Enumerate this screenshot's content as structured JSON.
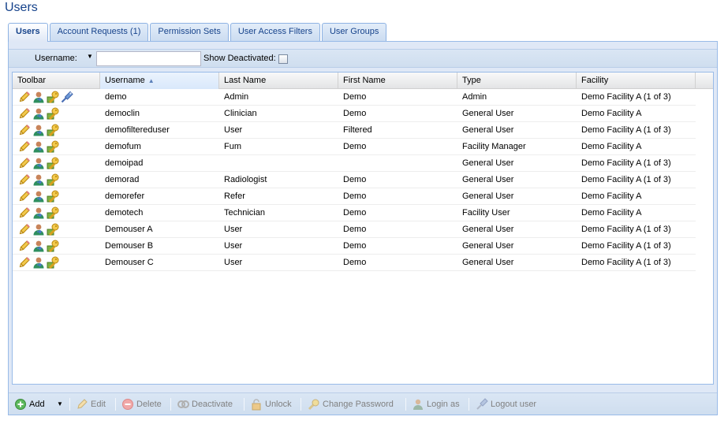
{
  "page": {
    "title": "Users"
  },
  "tabs": [
    {
      "label": "Users",
      "active": true
    },
    {
      "label": "Account Requests (1)",
      "active": false
    },
    {
      "label": "Permission Sets",
      "active": false
    },
    {
      "label": "User Access Filters",
      "active": false
    },
    {
      "label": "User Groups",
      "active": false
    }
  ],
  "filter": {
    "username_label": "Username:",
    "username_value": "",
    "show_deactivated_label": "Show Deactivated:",
    "show_deactivated_checked": false
  },
  "grid": {
    "columns": [
      "Toolbar",
      "Username",
      "Last Name",
      "First Name",
      "Type",
      "Facility"
    ],
    "sorted_column": "Username",
    "sort_direction": "ascending",
    "rows": [
      {
        "username": "demo",
        "last_name": "Admin",
        "first_name": "Demo",
        "type": "Admin",
        "facility": "Demo Facility A (1 of 3)",
        "icons": [
          "edit-icon",
          "login-as-icon",
          "change-password-icon",
          "logout-user-icon"
        ]
      },
      {
        "username": "democlin",
        "last_name": "Clinician",
        "first_name": "Demo",
        "type": "General User",
        "facility": "Demo Facility A",
        "icons": [
          "edit-icon",
          "login-as-icon",
          "change-password-icon"
        ]
      },
      {
        "username": "demofiltereduser",
        "last_name": "User",
        "first_name": "Filtered",
        "type": "General User",
        "facility": "Demo Facility A (1 of 3)",
        "icons": [
          "edit-icon",
          "login-as-icon",
          "change-password-icon"
        ]
      },
      {
        "username": "demofum",
        "last_name": "Fum",
        "first_name": "Demo",
        "type": "Facility Manager",
        "facility": "Demo Facility A",
        "icons": [
          "edit-icon",
          "login-as-icon",
          "change-password-icon"
        ]
      },
      {
        "username": "demoipad",
        "last_name": "",
        "first_name": "",
        "type": "General User",
        "facility": "Demo Facility A (1 of 3)",
        "icons": [
          "edit-icon",
          "login-as-icon",
          "change-password-icon"
        ]
      },
      {
        "username": "demorad",
        "last_name": "Radiologist",
        "first_name": "Demo",
        "type": "General User",
        "facility": "Demo Facility A (1 of 3)",
        "icons": [
          "edit-icon",
          "login-as-icon",
          "change-password-icon"
        ]
      },
      {
        "username": "demorefer",
        "last_name": "Refer",
        "first_name": "Demo",
        "type": "General User",
        "facility": "Demo Facility A",
        "icons": [
          "edit-icon",
          "login-as-icon",
          "change-password-icon"
        ]
      },
      {
        "username": "demotech",
        "last_name": "Technician",
        "first_name": "Demo",
        "type": "Facility User",
        "facility": "Demo Facility A",
        "icons": [
          "edit-icon",
          "login-as-icon",
          "change-password-icon"
        ]
      },
      {
        "username": "Demouser A",
        "last_name": "User",
        "first_name": "Demo",
        "type": "General User",
        "facility": "Demo Facility A (1 of 3)",
        "icons": [
          "edit-icon",
          "login-as-icon",
          "change-password-icon"
        ]
      },
      {
        "username": "Demouser B",
        "last_name": "User",
        "first_name": "Demo",
        "type": "General User",
        "facility": "Demo Facility A (1 of 3)",
        "icons": [
          "edit-icon",
          "login-as-icon",
          "change-password-icon"
        ]
      },
      {
        "username": "Demouser C",
        "last_name": "User",
        "first_name": "Demo",
        "type": "General User",
        "facility": "Demo Facility A (1 of 3)",
        "icons": [
          "edit-icon",
          "login-as-icon",
          "change-password-icon"
        ]
      }
    ]
  },
  "toolbar": {
    "add_label": "Add",
    "edit_label": "Edit",
    "delete_label": "Delete",
    "deactivate_label": "Deactivate",
    "unlock_label": "Unlock",
    "change_password_label": "Change Password",
    "login_as_label": "Login as",
    "logout_user_label": "Logout user"
  },
  "colors": {
    "title": "#15428b",
    "panel_bg": "#dfe8f6",
    "panel_border": "#99bbe8",
    "disabled_text": "#808080"
  }
}
